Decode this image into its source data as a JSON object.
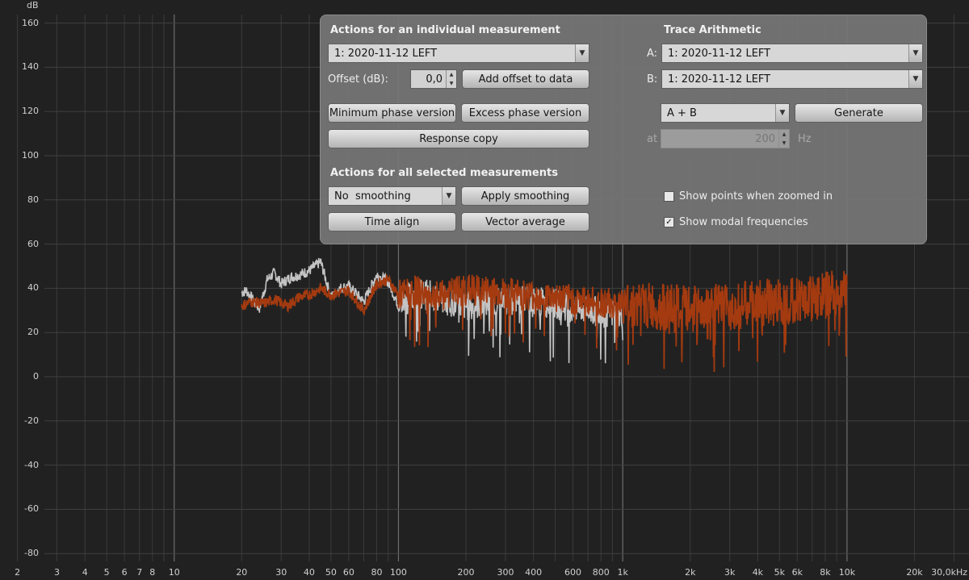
{
  "chart_data": {
    "type": "line",
    "title": "",
    "xlabel": "",
    "ylabel": "dB",
    "x_scale": "log",
    "xlim": [
      1.7,
      35000
    ],
    "ylim": [
      -82,
      163
    ],
    "grid": true,
    "y_ticks": [
      "160",
      "140",
      "120",
      "100",
      "80",
      "60",
      "40",
      "20",
      "0",
      "-20",
      "-40",
      "-60",
      "-80"
    ],
    "x_ticks": [
      "2",
      "3",
      "4",
      "5",
      "6",
      "7",
      "8",
      "10",
      "20",
      "30",
      "40",
      "50",
      "60",
      "80",
      "100",
      "200",
      "300",
      "400",
      "600",
      "800",
      "1k",
      "2k",
      "3k",
      "4k",
      "5k",
      "6k",
      "8k",
      "10k",
      "20k",
      "30,0kHz"
    ],
    "series": [
      {
        "color": "#c4c4c4",
        "x": [
          20,
          21,
          22,
          23,
          24,
          26,
          28,
          30,
          33,
          36,
          40,
          45,
          50,
          55,
          60,
          70,
          80,
          90,
          100,
          120,
          150,
          200,
          300,
          500,
          700,
          1000
        ],
        "y": [
          38,
          39,
          36,
          33,
          31,
          44,
          47,
          42,
          45,
          46,
          48,
          52,
          36,
          40,
          41,
          34,
          46,
          43,
          32,
          38,
          36,
          32,
          35,
          33,
          30,
          28
        ]
      },
      {
        "color": "#a33a10",
        "x": [
          20,
          22,
          25,
          28,
          32,
          36,
          40,
          45,
          50,
          60,
          70,
          80,
          90,
          100,
          120,
          150,
          200,
          300,
          500,
          700,
          1000,
          2000,
          5000,
          10000
        ],
        "y": [
          32,
          34,
          33,
          35,
          32,
          36,
          37,
          40,
          37,
          39,
          30,
          42,
          44,
          37,
          39,
          36,
          40,
          38,
          36,
          34,
          33,
          30,
          34,
          38
        ]
      }
    ]
  },
  "panel": {
    "individual_title": "Actions for an individual measurement",
    "measurement_select": "1: 2020-11-12 LEFT",
    "offset_label": "Offset (dB):",
    "offset_value": "0,0",
    "add_offset_button": "Add offset to data",
    "min_phase_button": "Minimum phase version",
    "excess_phase_button": "Excess phase version",
    "response_copy_button": "Response copy",
    "all_title": "Actions for all selected measurements",
    "smoothing_select": "No  smoothing",
    "apply_smoothing_button": "Apply smoothing",
    "time_align_button": "Time align",
    "vector_average_button": "Vector average",
    "trace_title": "Trace Arithmetic",
    "a_label": "A:",
    "a_select": "1: 2020-11-12 LEFT",
    "b_label": "B:",
    "b_select": "1: 2020-11-12 LEFT",
    "op_select": "A + B",
    "generate_button": "Generate",
    "at_label": "at",
    "at_value": "200",
    "hz_label": "Hz",
    "show_points_label": "Show points when zoomed in",
    "show_points_checked": false,
    "show_modal_label": "Show modal frequencies",
    "show_modal_checked": true
  }
}
